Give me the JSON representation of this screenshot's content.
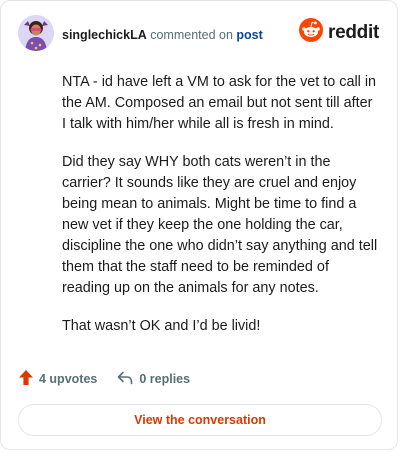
{
  "header": {
    "username": "singlechickLA",
    "commented_on": "commented on",
    "post_link": "post",
    "brand_name": "reddit"
  },
  "comment": {
    "paragraphs": [
      "NTA - id have left a VM to ask for the vet to call in the AM. Composed an email but not sent till after I talk with him/her while all is fresh in mind.",
      "Did they say WHY both cats weren’t in the carrier? It sounds like they are cruel and enjoy being mean to animals. Might be time to find a new vet if they keep the one holding the car, discipline the one who didn’t say anything and tell them that the staff need to be reminded of reading up on the animals for any notes.",
      "That wasn’t OK and I’d be livid!"
    ]
  },
  "actions": {
    "upvotes": "4 upvotes",
    "replies": "0 replies"
  },
  "cta": {
    "label": "View the conversation"
  },
  "colors": {
    "brand_orange": "#ff4500",
    "upvote_orange": "#d93a00",
    "link_blue": "#0a449b",
    "text_dark": "#1c1c1c",
    "text_muted": "#576f76",
    "border": "#e3e6ea"
  },
  "icons": {
    "brand": "reddit-snoo-icon",
    "upvote": "upvote-arrow-icon",
    "reply": "reply-arrow-icon",
    "avatar": "user-avatar"
  }
}
